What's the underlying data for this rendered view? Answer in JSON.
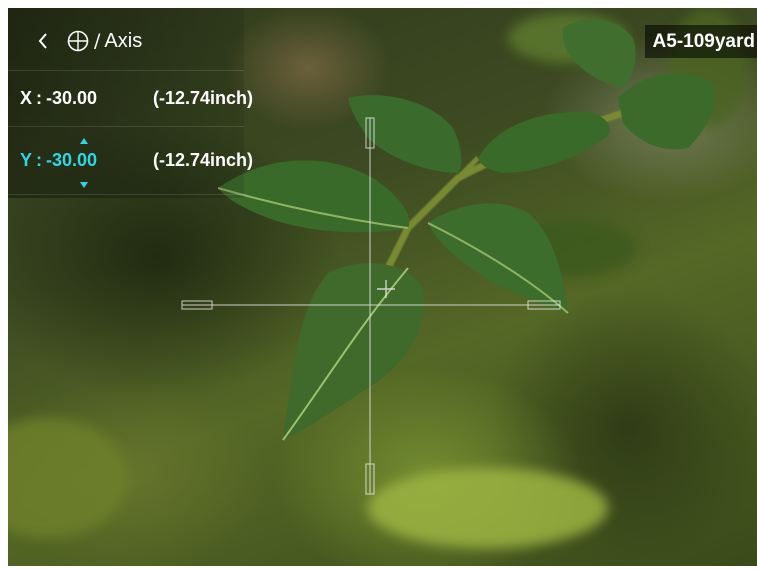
{
  "header": {
    "back_icon": "chevron-left-icon",
    "reticle_icon": "crosshair-circle-icon",
    "separator": "/",
    "title": "Axis"
  },
  "axes": [
    {
      "label": "X",
      "separator": ":",
      "value": "-30.00",
      "inch": "(-12.74inch)",
      "selected": false
    },
    {
      "label": "Y",
      "separator": ":",
      "value": "-30.00",
      "inch": "(-12.74inch)",
      "selected": true
    }
  ],
  "profile_badge": "A5-109yard",
  "colors": {
    "selected": "#30d6e6",
    "text": "#ffffff",
    "reticle": "#e8e8e8"
  }
}
